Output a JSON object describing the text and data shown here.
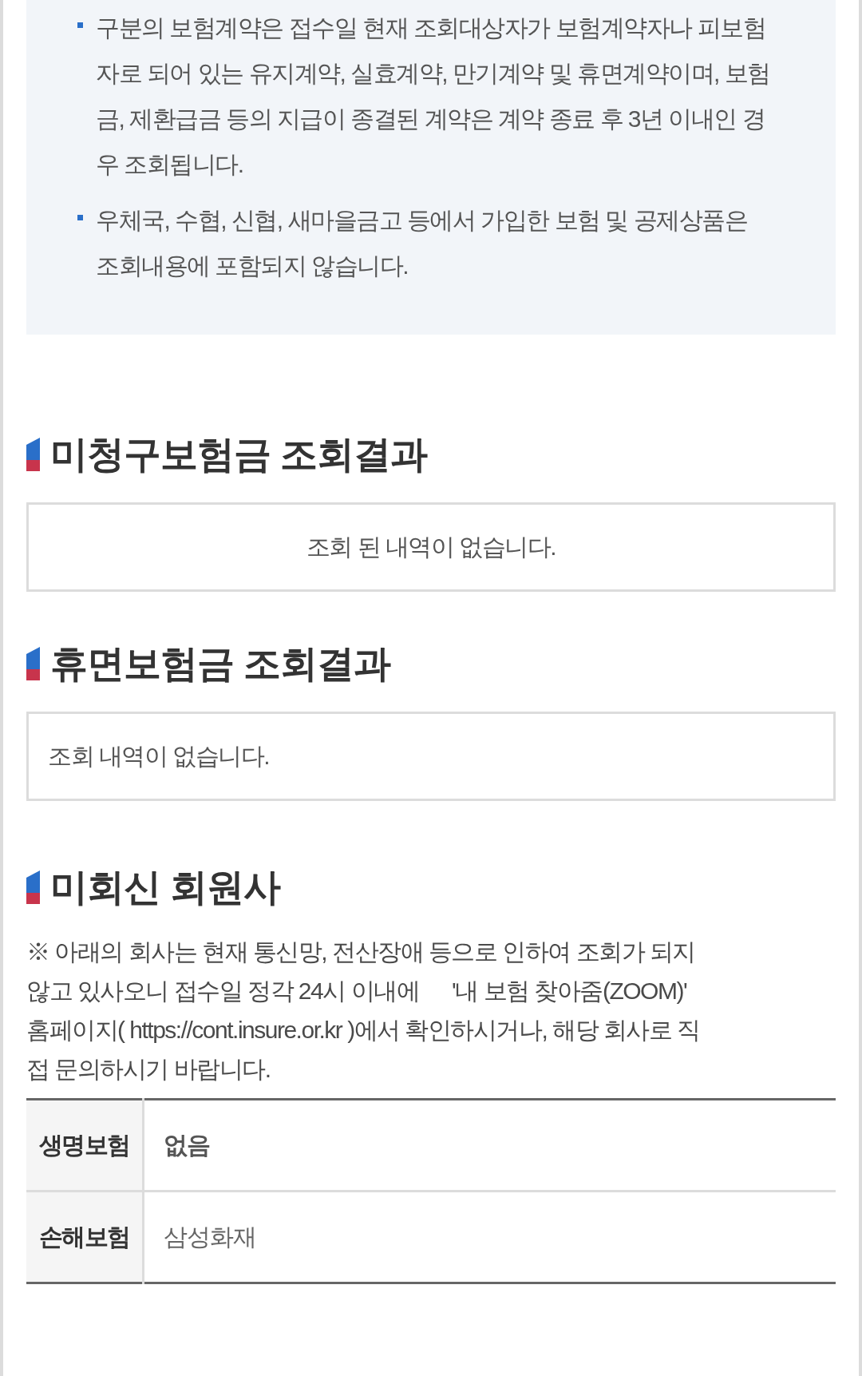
{
  "notice_box": {
    "items": [
      {
        "text": "구분의 보험계약은 접수일 현재 조회대상자가 보험계약자나 피보험자로 되어 있는 유지계약, 실효계약, 만기계약 및 휴면계약이며, 보험금, 제환급금 등의 지급이 종결된 계약은 계약 종료 후 3년 이내인 경우 조회됩니다."
      },
      {
        "text": "우체국, 수협, 신협, 새마을금고 등에서 가입한 보험 및 공제상품은 조회내용에 포함되지 않습니다."
      }
    ]
  },
  "unclaimed_result": {
    "title": "미청구보험금 조회결과",
    "message": "조회 된 내역이 없습니다."
  },
  "dormant_result": {
    "title": "휴면보험금 조회결과",
    "message": "조회 내역이 없습니다."
  },
  "unresponsive_members": {
    "title": "미회신 회원사",
    "note": "※ 아래의 회사는 현재 통신망, 전산장애 등으로 인하여 조회가 되지않고 있사오니 접수일 정각 24시 이내에      '내 보험 찾아줌(ZOOM)' 홈페이지( https://cont.insure.or.kr )에서 확인하시거나, 해당 회사로 직접 문의하시기 바랍니다.",
    "table": {
      "rows": [
        {
          "header": "생명보험",
          "value": "없음",
          "emphasized": true
        },
        {
          "header": "손해보험",
          "value": "삼성화재",
          "emphasized": false
        }
      ]
    }
  }
}
